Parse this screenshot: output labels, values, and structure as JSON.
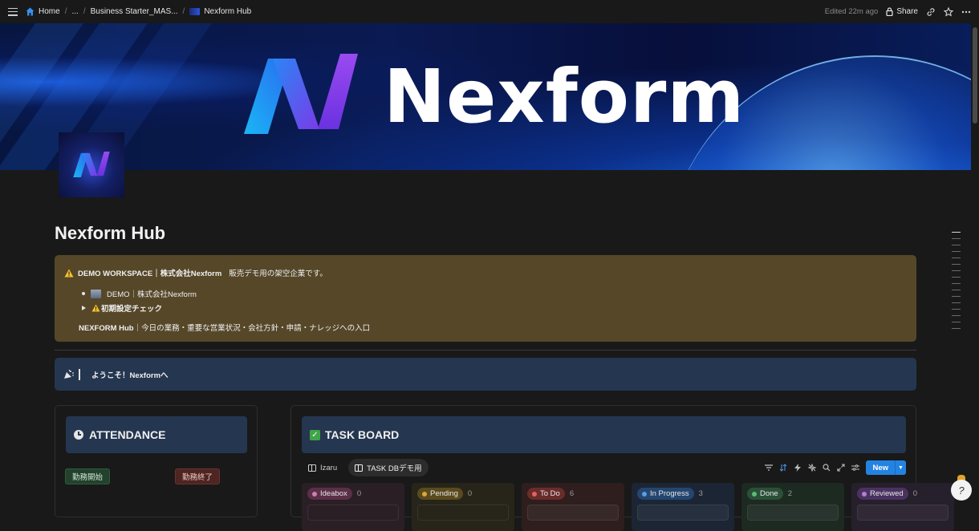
{
  "topbar": {
    "crumbs": [
      "Home",
      "...",
      "Business Starter_MAS...",
      "Nexform Hub"
    ],
    "edited": "Edited 22m ago",
    "share": "Share"
  },
  "cover": {
    "logo_text": "Nexform"
  },
  "page": {
    "title": "Nexform Hub"
  },
  "warning_callout": {
    "line1_bold": "DEMO WORKSPACE｜株式会社Nexform",
    "line1_rest": "販売デモ用の架空企業です。",
    "bullet1": "DEMO｜株式会社Nexform",
    "toggle1": "初期設定チェック",
    "line3_bold": "NEXFORM Hub",
    "line3_rest": "｜今日の業務・重要な営業状況・会社方針・申請・ナレッジへの入口"
  },
  "welcome_callout": {
    "text": "ようこそ！Nexformへ"
  },
  "attendance": {
    "title": "ATTENDANCE",
    "start_label": "勤務開始",
    "end_label": "勤務終了"
  },
  "taskboard": {
    "title": "TASK BOARD",
    "views": [
      "Izaru",
      "TASK DBデモ用"
    ],
    "new_label": "New",
    "groups": [
      {
        "label": "Ideabox",
        "count": "0",
        "bg": "#2a1f24",
        "tag_bg": "#5a2f47",
        "dot": "#d07fb0",
        "card": ""
      },
      {
        "label": "Pending",
        "count": "0",
        "bg": "#272519",
        "tag_bg": "#5a4a1e",
        "dot": "#d7a83a",
        "card": ""
      },
      {
        "label": "To Do",
        "count": "6",
        "bg": "#2e1e1e",
        "tag_bg": "#6a2c2a",
        "dot": "#e0655e",
        "card": ""
      },
      {
        "label": "In Progress",
        "count": "3",
        "bg": "#1c2534",
        "tag_bg": "#24466f",
        "dot": "#5b9de3",
        "card": ""
      },
      {
        "label": "Done",
        "count": "2",
        "bg": "#1d2a22",
        "tag_bg": "#2a5038",
        "dot": "#5dbb77",
        "card": ""
      },
      {
        "label": "Reviewed",
        "count": "0",
        "bg": "#261f2c",
        "tag_bg": "#4a3260",
        "dot": "#b07fd8",
        "card": ""
      }
    ]
  }
}
